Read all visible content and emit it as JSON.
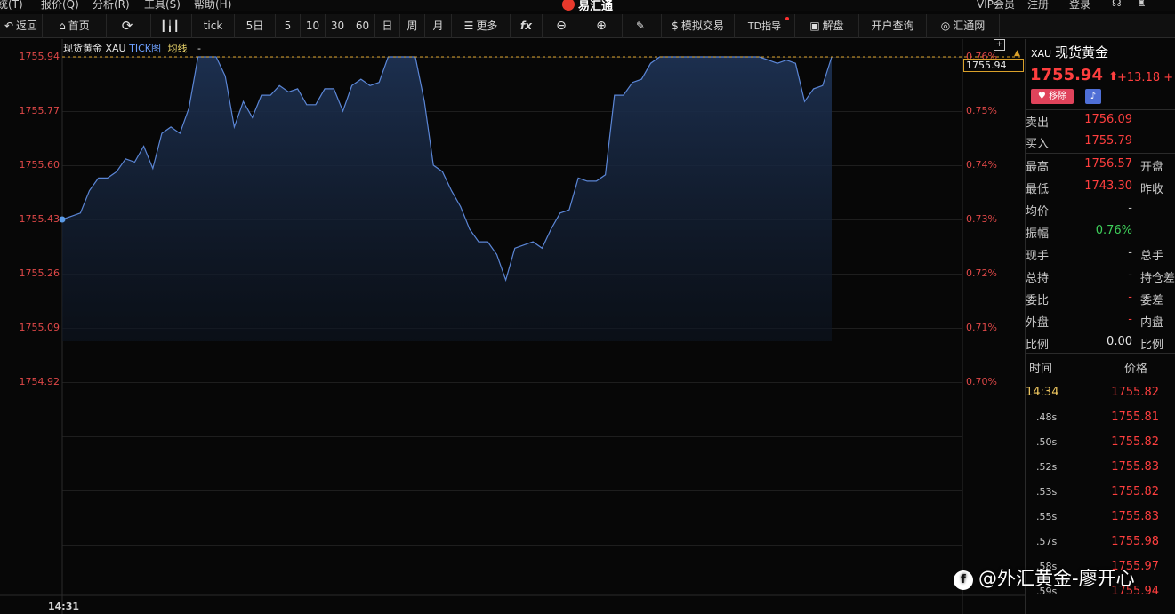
{
  "menu": {
    "items": [
      "统(T)",
      "报价(Q)",
      "分析(R)",
      "工具(S)",
      "帮助(H)"
    ],
    "app_title": "易汇通",
    "right": [
      "VIP会员",
      "注册",
      "登录"
    ]
  },
  "toolbar": {
    "back": "返回",
    "home": "首页",
    "tick": "tick",
    "five_day": "5日",
    "p5": "5",
    "p10": "10",
    "p30": "30",
    "p60": "60",
    "day": "日",
    "week": "周",
    "month": "月",
    "more": "更多",
    "fx": "fx",
    "sim_trade": "模拟交易",
    "td_guide": "TD指导",
    "analysis": "解盘",
    "open_account": "开户查询",
    "huitong": "汇通网"
  },
  "chart_header": {
    "name": "现货黄金",
    "symbol": "XAU",
    "type": "TICK图",
    "avg": "均线",
    "avg_value": "-"
  },
  "chart_data": {
    "type": "area",
    "y_ticks": [
      1755.94,
      1755.77,
      1755.6,
      1755.43,
      1755.26,
      1755.09,
      1754.92
    ],
    "pct_ticks": [
      "0.76%",
      "0.75%",
      "0.74%",
      "0.73%",
      "0.72%",
      "0.71%",
      "0.70%"
    ],
    "x_tick_labels": [
      "14:31"
    ],
    "current_price_label": "1755.94",
    "ylim": [
      1754.92,
      1755.94
    ],
    "values": [
      1755.43,
      1755.44,
      1755.45,
      1755.52,
      1755.56,
      1755.56,
      1755.58,
      1755.62,
      1755.61,
      1755.66,
      1755.59,
      1755.7,
      1755.72,
      1755.7,
      1755.78,
      1755.94,
      1755.94,
      1755.94,
      1755.88,
      1755.72,
      1755.8,
      1755.75,
      1755.82,
      1755.82,
      1755.85,
      1755.83,
      1755.84,
      1755.79,
      1755.79,
      1755.84,
      1755.84,
      1755.77,
      1755.85,
      1755.87,
      1755.85,
      1755.86,
      1755.94,
      1755.94,
      1755.94,
      1755.94,
      1755.8,
      1755.6,
      1755.58,
      1755.52,
      1755.47,
      1755.4,
      1755.36,
      1755.36,
      1755.32,
      1755.24,
      1755.34,
      1755.35,
      1755.36,
      1755.34,
      1755.4,
      1755.45,
      1755.46,
      1755.56,
      1755.55,
      1755.55,
      1755.57,
      1755.82,
      1755.82,
      1755.86,
      1755.87,
      1755.92,
      1755.94,
      1755.94,
      1755.94,
      1755.94,
      1755.94,
      1755.94,
      1755.94,
      1755.94,
      1755.94,
      1755.94,
      1755.94,
      1755.94,
      1755.93,
      1755.92,
      1755.93,
      1755.92,
      1755.8,
      1755.84,
      1755.85,
      1755.94
    ]
  },
  "panel": {
    "code": "XAU",
    "name": "现货黄金",
    "price": "1755.94",
    "arrow": "⬆",
    "change": "+13.18",
    "change_extra": "+",
    "remove": "移除",
    "quotes": [
      {
        "label": "卖出",
        "value": "1756.09",
        "color": "#ff3f3f"
      },
      {
        "label": "买入",
        "value": "1755.79",
        "color": "#ff3f3f"
      },
      {
        "label": "最高",
        "value": "1756.57",
        "color": "#ff3f3f",
        "label2": "开盘"
      },
      {
        "label": "最低",
        "value": "1743.30",
        "color": "#ff3f3f",
        "label2": "昨收"
      },
      {
        "label": "均价",
        "value": "-",
        "color": "#c8c8c8"
      },
      {
        "label": "振幅",
        "value": "0.76%",
        "color": "#3ecf5a"
      },
      {
        "label": "现手",
        "value": "-",
        "color": "#c8c8c8",
        "label2": "总手"
      },
      {
        "label": "总持",
        "value": "-",
        "color": "#c8c8c8",
        "label2": "持仓差"
      },
      {
        "label": "委比",
        "value": "-",
        "color": "#ff3f3f",
        "label2": "委差"
      },
      {
        "label": "外盘",
        "value": "-",
        "color": "#ff3f3f",
        "label2": "内盘"
      },
      {
        "label": "比例",
        "value": "0.00",
        "color": "#e8e8e8",
        "label2": "比例"
      }
    ],
    "ticks_header": {
      "time": "时间",
      "price": "价格"
    },
    "ticks": [
      {
        "time": "14:34",
        "price": "1755.82"
      },
      {
        "time": ".48s",
        "price": "1755.81"
      },
      {
        "time": ".50s",
        "price": "1755.82"
      },
      {
        "time": ".52s",
        "price": "1755.83"
      },
      {
        "time": ".53s",
        "price": "1755.82"
      },
      {
        "time": ".55s",
        "price": "1755.83"
      },
      {
        "time": ".57s",
        "price": "1755.98"
      },
      {
        "time": ".58s",
        "price": "1755.97"
      },
      {
        "time": ".59s",
        "price": "1755.94"
      }
    ]
  },
  "watermark": "@外汇黄金-廖开心",
  "colors": {
    "line": "#5b86d6",
    "fill": "#1a2a44",
    "up": "#ff3f3f",
    "axis_text": "#e04848",
    "dashed_current": "#d9a02a"
  }
}
